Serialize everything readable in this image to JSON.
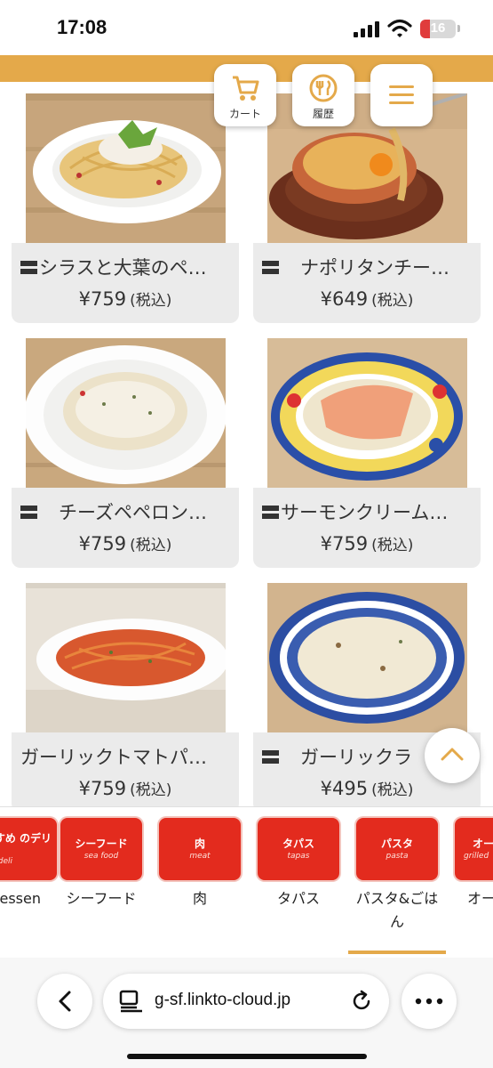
{
  "status_bar": {
    "time": "17:08",
    "battery": "16"
  },
  "header": {
    "cart_label": "カート",
    "history_label": "履歴"
  },
  "menu_items": [
    {
      "name": "シラスと大葉のペ…",
      "price": "¥759",
      "tax": "(税込)"
    },
    {
      "name": "ナポリタンチー…",
      "price": "¥649",
      "tax": "(税込)"
    },
    {
      "name": "チーズペペロン…",
      "price": "¥759",
      "tax": "(税込)"
    },
    {
      "name": "サーモンクリーム…",
      "price": "¥759",
      "tax": "(税込)"
    },
    {
      "name": "ガーリックトマトパ…",
      "price": "¥759",
      "tax": "(税込)"
    },
    {
      "name": "ガーリックラ",
      "price": "¥495",
      "tax": "(税込)"
    }
  ],
  "categories": [
    {
      "icon_jp": "すすめ のデリ",
      "icon_en": "deli",
      "label": "atessen"
    },
    {
      "icon_jp": "シーフード",
      "icon_en": "sea food",
      "label": "シーフード"
    },
    {
      "icon_jp": "肉",
      "icon_en": "meat",
      "label": "肉"
    },
    {
      "icon_jp": "タパス",
      "icon_en": "tapas",
      "label": "タパス"
    },
    {
      "icon_jp": "パスタ",
      "icon_en": "pasta",
      "label": "パスタ&ごはん"
    },
    {
      "icon_jp": "オー",
      "icon_en": "grilled",
      "label": "オー"
    }
  ],
  "browser": {
    "url": "g-sf.linkto-cloud.jp"
  },
  "colors": {
    "accent_gold": "#e4a94a",
    "category_red": "#e32b1e",
    "card_bg": "#ebebeb"
  }
}
